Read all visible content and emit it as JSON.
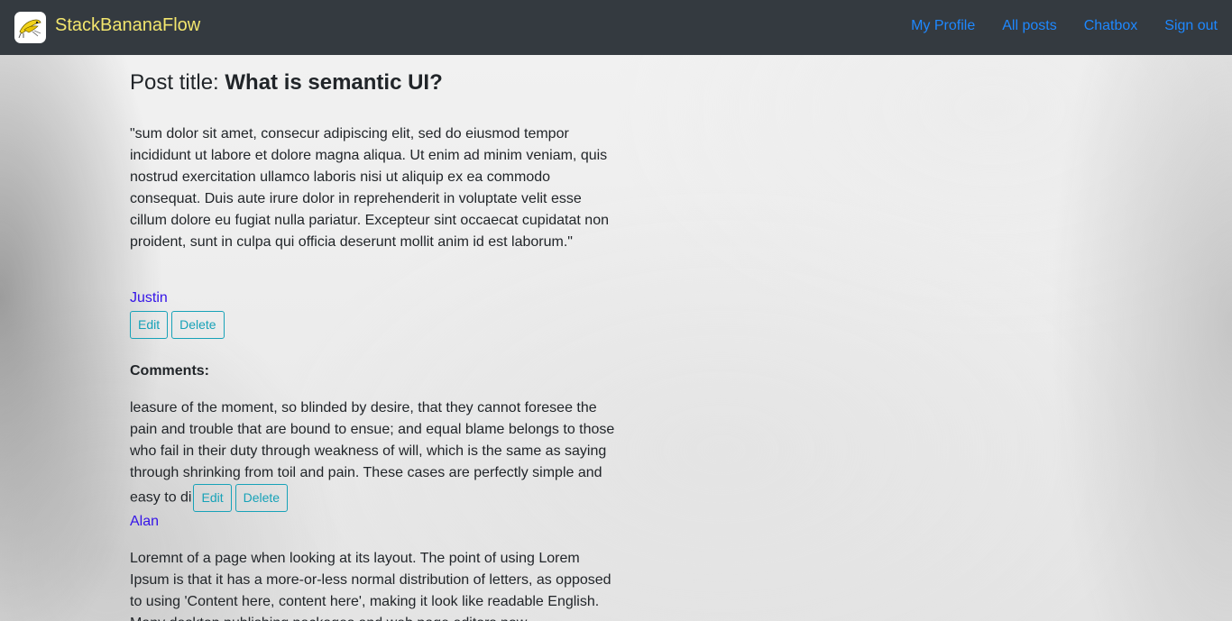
{
  "navbar": {
    "brand": "StackBananaFlow",
    "logo_icon": "banana-bird-logo-icon",
    "links": [
      "My Profile",
      "All posts",
      "Chatbox",
      "Sign out"
    ]
  },
  "post": {
    "title_prefix": "Post title: ",
    "title": "What is semantic UI?",
    "body": "\"sum dolor sit amet, consecur adipiscing elit, sed do eiusmod tempor incididunt ut labore et dolore magna aliqua. Ut enim ad minim veniam, quis nostrud exercitation ullamco laboris nisi ut aliquip ex ea commodo consequat. Duis aute irure dolor in reprehenderit in voluptate velit esse cillum dolore eu fugiat nulla pariatur. Excepteur sint occaecat cupidatat non proident, sunt in culpa qui officia deserunt mollit anim id est laborum.\"",
    "author": "Justin",
    "edit_label": "Edit",
    "delete_label": "Delete"
  },
  "comments": {
    "heading": "Comments:",
    "items": [
      {
        "text": "leasure of the moment, so blinded by desire, that they cannot foresee the pain and trouble that are bound to ensue; and equal blame belongs to those who fail in their duty through weakness of will, which is the same as saying through shrinking from toil and pain. These cases are perfectly simple and easy to di",
        "author": "Alan",
        "edit_label": "Edit",
        "delete_label": "Delete"
      },
      {
        "text": "Loremnt of a page when looking at its layout. The point of using Lorem Ipsum is that it has a more-or-less normal distribution of letters, as opposed to using 'Content here, content here', making it look like readable English. Many desktop publishing packages and web page editors now"
      }
    ]
  },
  "colors": {
    "navbar_bg": "#343a40",
    "brand": "#f3e66e",
    "nav_link": "#1e88ff",
    "author_link": "#3413e8",
    "button_outline": "#17a2b8"
  }
}
